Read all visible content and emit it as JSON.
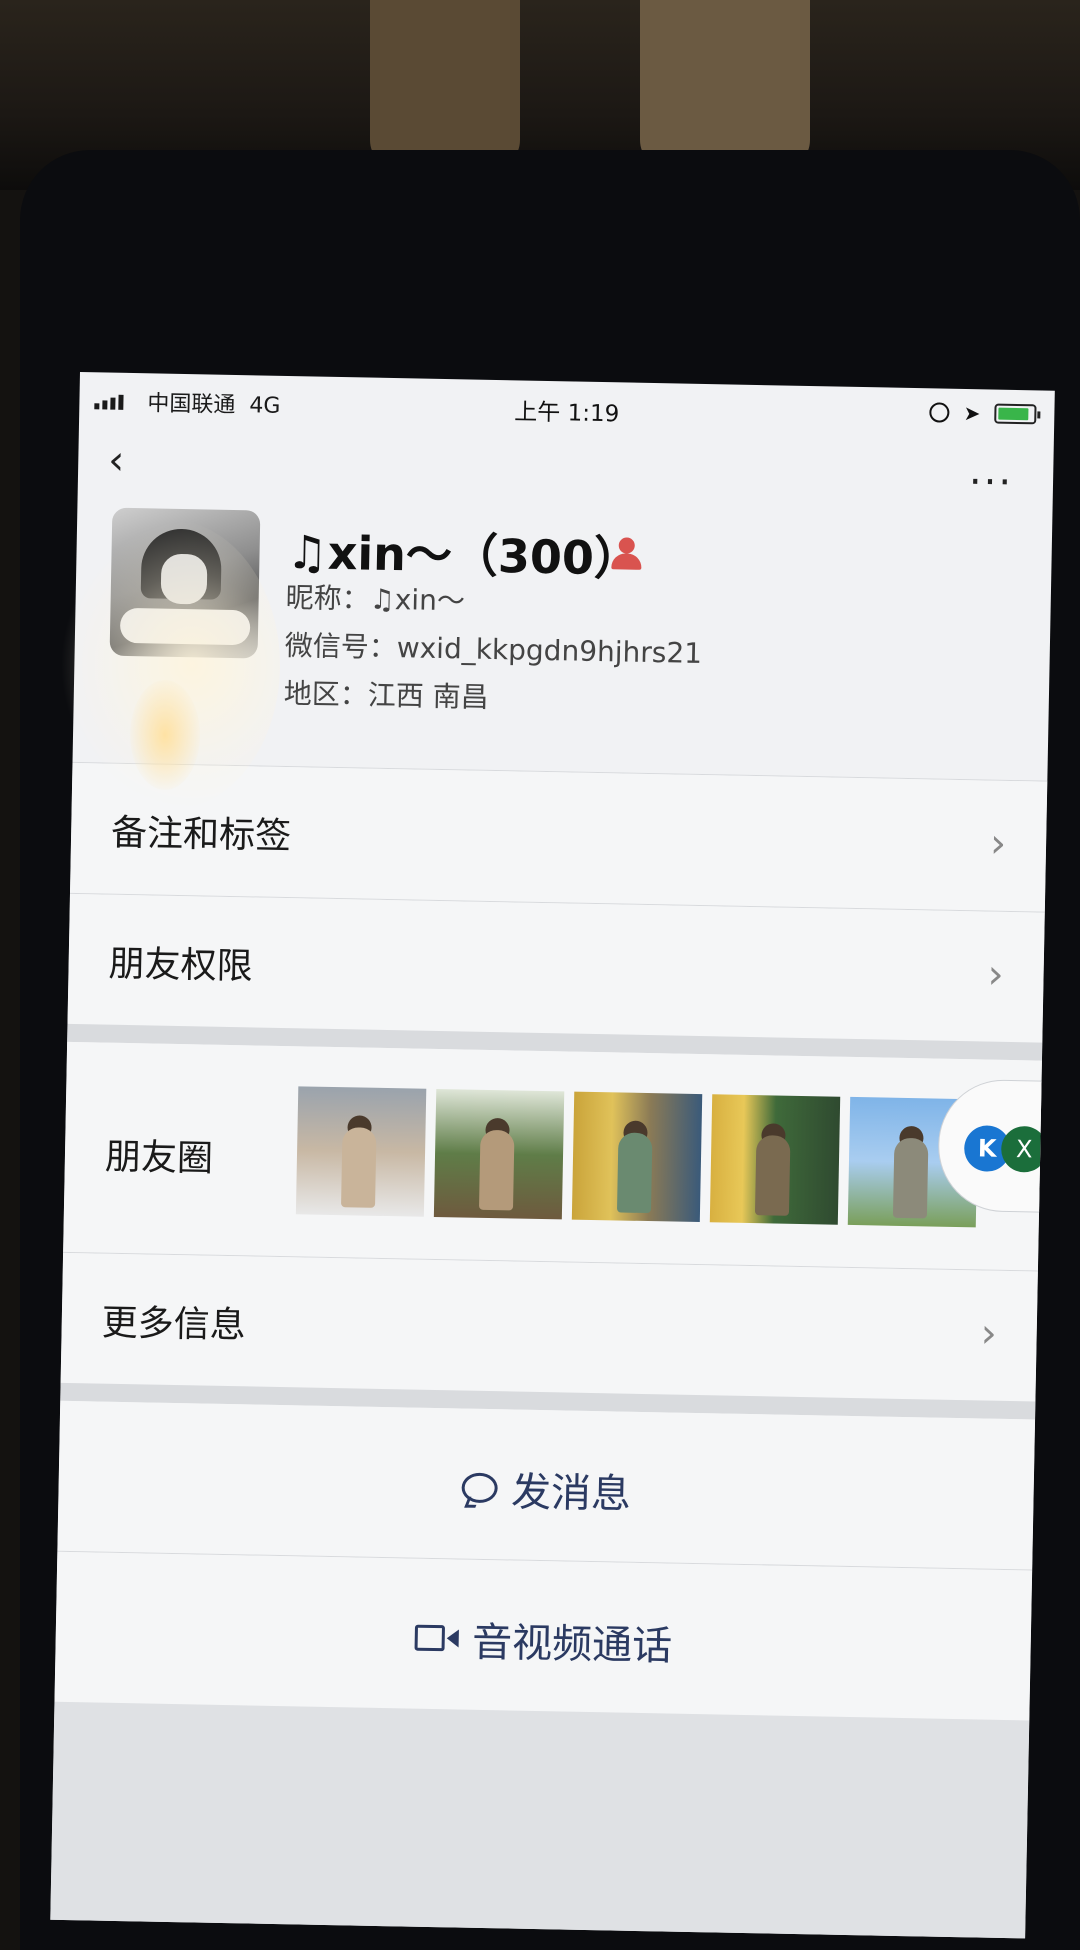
{
  "status_bar": {
    "carrier": "中国联通",
    "network": "4G",
    "time": "上午 1:19"
  },
  "profile": {
    "name": "♫xin～（300）",
    "nickname": "昵称：♫xin～",
    "wechat_id": "微信号：wxid_kkpgdn9hjhrs21",
    "region": "地区：江西 南昌"
  },
  "rows": {
    "remark": "备注和标签",
    "permissions": "朋友权限",
    "moments": "朋友圈",
    "more_info": "更多信息"
  },
  "float": {
    "k_label": "K",
    "x_label": "X"
  },
  "actions": {
    "message": "发消息",
    "call": "音视频通话"
  },
  "icons": {
    "back": "chevron-left-icon",
    "more": "more-dots-icon",
    "chevron": "chevron-right-icon",
    "message": "chat-bubble-icon",
    "call": "video-camera-icon",
    "gender": "female-icon"
  },
  "colors": {
    "accent": "#2b3a62",
    "gender": "#d9534f",
    "battery": "#39b54a"
  }
}
